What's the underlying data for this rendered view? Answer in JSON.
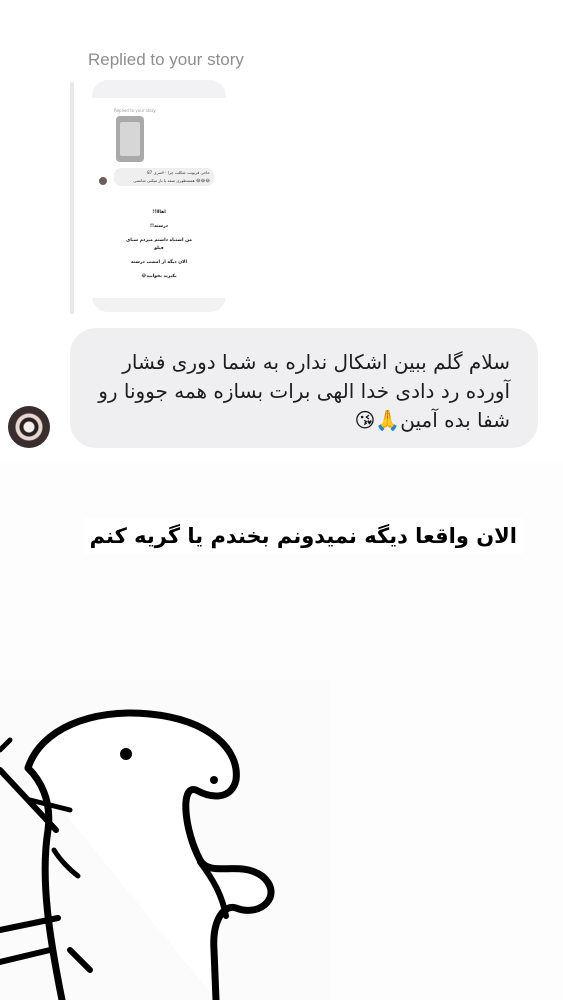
{
  "story_reply": {
    "label": "Replied to your story",
    "thumbnail": {
      "replied_label": "Replied to your story",
      "bubble_text_1": "حاجی قربونت شکلت چرا ۴۰سری 87",
      "bubble_text_2": "همسطوری سفه یا بار میکنی شانسی 😂😂😂",
      "lines": [
        "اهااا!!",
        "درسته!!",
        "من اشتباه داشتم میزدم شبای",
        "فیلو",
        "الان دیگه از امشب درسته",
        "بکیرید بخوابید😂"
      ]
    }
  },
  "message": {
    "text": "سلام گلم ببین اشکال نداره به شما دوری فشار آورده رد دادی خدا الهی برات بسازه همه جوونا رو شفا بده آمین🙏😘"
  },
  "meme": {
    "caption": "الان واقعا دیگه نمیدونم بخندم یا گریه کنم"
  }
}
